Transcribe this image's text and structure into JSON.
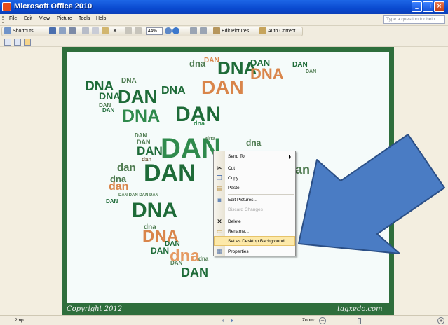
{
  "window": {
    "title": "Microsoft Office 2010"
  },
  "menubar": {
    "items": [
      "File",
      "Edit",
      "View",
      "Picture",
      "Tools",
      "Help"
    ],
    "help_placeholder": "Type a question for help"
  },
  "toolbar": {
    "shortcuts_label": "Shortcuts...",
    "zoom_value": "44%",
    "edit_pictures_label": "Edit Pictures...",
    "auto_correct_label": "Auto Correct"
  },
  "image": {
    "copyright": "Copyright 2012",
    "watermark": "tagxedo.com"
  },
  "context_menu": {
    "items": [
      {
        "label": "Send To",
        "icon": "none",
        "submenu": true
      },
      {
        "label": "Cut",
        "icon": "scissors-icon"
      },
      {
        "label": "Copy",
        "icon": "copy-icon"
      },
      {
        "label": "Paste",
        "icon": "paste-icon"
      },
      {
        "label": "Edit Pictures...",
        "icon": "edit-pictures-icon"
      },
      {
        "label": "Discard Changes",
        "icon": "none",
        "disabled": true
      },
      {
        "label": "Delete",
        "icon": "delete-x-icon"
      },
      {
        "label": "Rename...",
        "icon": "rename-icon"
      },
      {
        "label": "Set as Desktop Background",
        "icon": "none",
        "highlighted": true
      },
      {
        "label": "Properties",
        "icon": "properties-icon"
      }
    ]
  },
  "statusbar": {
    "image_size": "2mp",
    "zoom_label": "Zoom:"
  },
  "colors": {
    "arrow_fill": "#4a7cc4",
    "arrow_stroke": "#2b4f86",
    "frame": "#2e6e3c",
    "menu_highlight": "#fde9a9"
  }
}
